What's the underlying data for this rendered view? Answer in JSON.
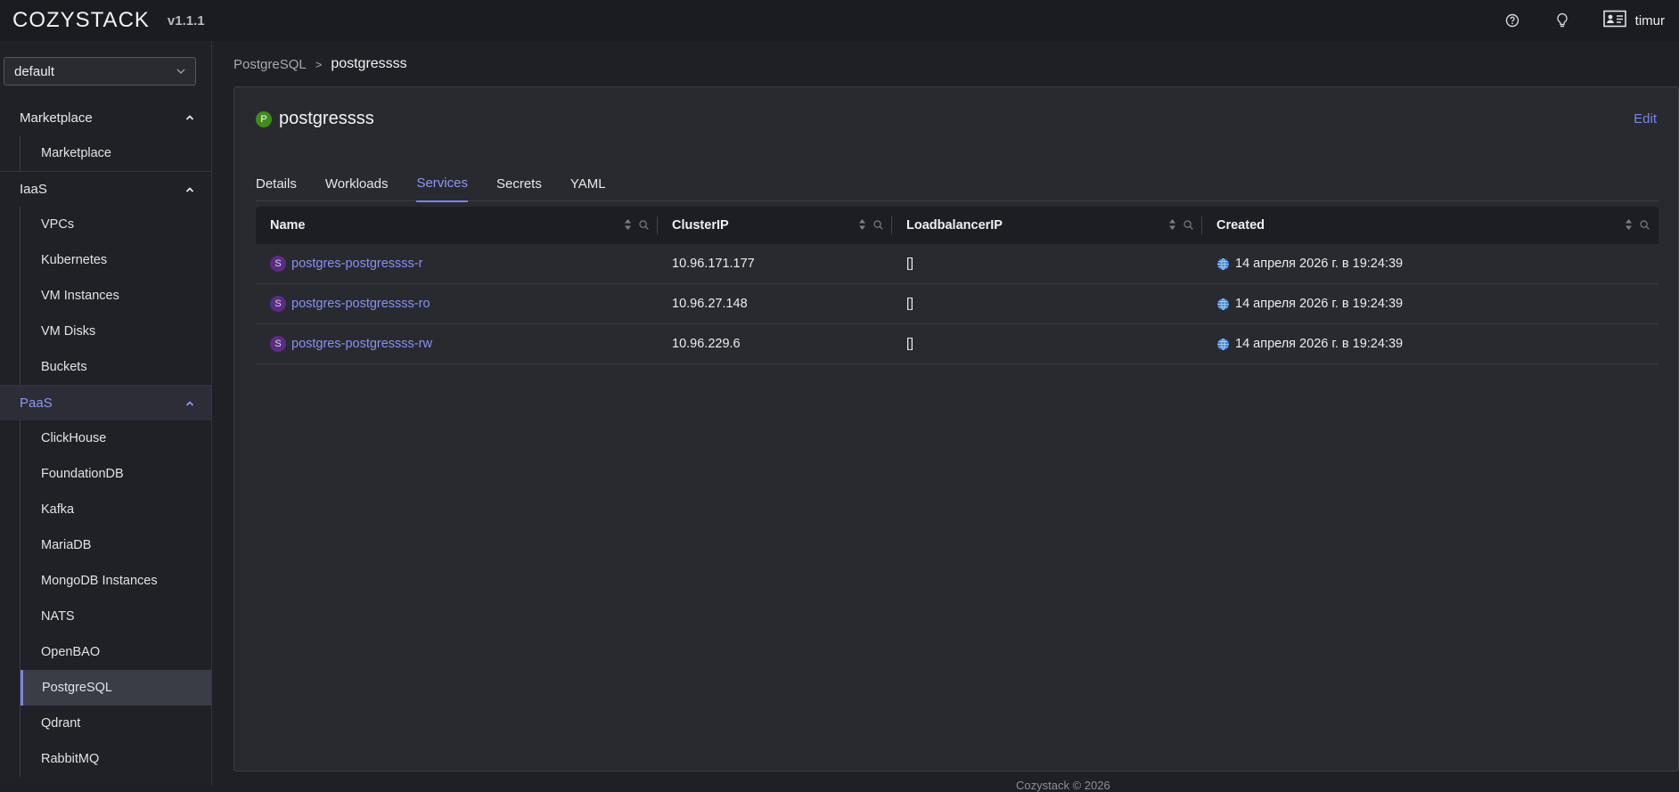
{
  "header": {
    "brand": "COZYSTACK",
    "version": "v1.1.1",
    "user": "timur"
  },
  "sidebar": {
    "namespace": "default",
    "groups": [
      {
        "label": "Marketplace",
        "items": [
          "Marketplace"
        ]
      },
      {
        "label": "IaaS",
        "items": [
          "VPCs",
          "Kubernetes",
          "VM Instances",
          "VM Disks",
          "Buckets"
        ]
      },
      {
        "label": "PaaS",
        "items": [
          "ClickHouse",
          "FoundationDB",
          "Kafka",
          "MariaDB",
          "MongoDB Instances",
          "NATS",
          "OpenBAO",
          "PostgreSQL",
          "Qdrant",
          "RabbitMQ"
        ]
      }
    ]
  },
  "breadcrumb": {
    "parent": "PostgreSQL",
    "separator": ">",
    "current": "postgressss"
  },
  "resource": {
    "badge": "P",
    "name": "postgressss",
    "edit_label": "Edit"
  },
  "tabs": [
    "Details",
    "Workloads",
    "Services",
    "Secrets",
    "YAML"
  ],
  "active_tab": "Services",
  "table": {
    "columns": [
      "Name",
      "ClusterIP",
      "LoadbalancerIP",
      "Created"
    ],
    "rows": [
      {
        "badge": "S",
        "name": "postgres-postgressss-r",
        "cluster_ip": "10.96.171.177",
        "lb_ip": "[]",
        "created": "14 апреля 2026 г. в 19:24:39"
      },
      {
        "badge": "S",
        "name": "postgres-postgressss-ro",
        "cluster_ip": "10.96.27.148",
        "lb_ip": "[]",
        "created": "14 апреля 2026 г. в 19:24:39"
      },
      {
        "badge": "S",
        "name": "postgres-postgressss-rw",
        "cluster_ip": "10.96.229.6",
        "lb_ip": "[]",
        "created": "14 апреля 2026 г. в 19:24:39"
      }
    ]
  },
  "footer": "Cozystack © 2026"
}
